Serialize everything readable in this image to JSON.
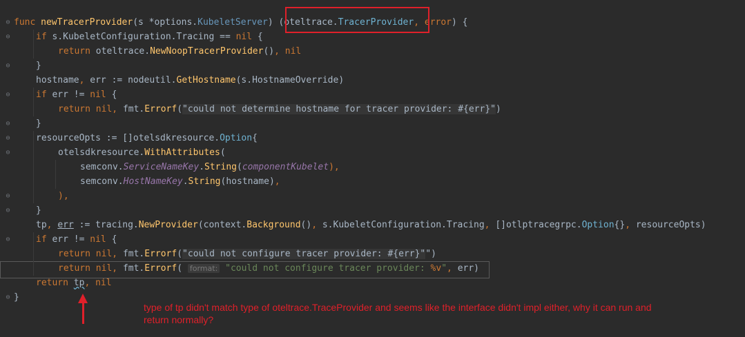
{
  "code_lines": [
    {
      "indent": 0,
      "segments": [
        [
          "kw",
          "func "
        ],
        [
          "fn",
          "newTracerProvider"
        ],
        [
          "",
          "(s *options."
        ],
        [
          "typ",
          "KubeletServer"
        ],
        [
          "",
          ") ("
        ],
        [
          "",
          "oteltrace."
        ],
        [
          "cyan",
          "TracerProvider"
        ],
        [
          "kw",
          ", "
        ],
        [
          "kw",
          "error"
        ],
        [
          "",
          ") {"
        ]
      ]
    },
    {
      "indent": 1,
      "segments": [
        [
          "kw",
          "if "
        ],
        [
          "",
          "s.KubeletConfiguration.Tracing == "
        ],
        [
          "kw",
          "nil"
        ],
        [
          "",
          " {"
        ]
      ]
    },
    {
      "indent": 2,
      "segments": [
        [
          "kw",
          "return "
        ],
        [
          "",
          "oteltrace."
        ],
        [
          "fn",
          "NewNoopTracerProvider"
        ],
        [
          "",
          "()"
        ],
        [
          "kw",
          ", nil"
        ]
      ]
    },
    {
      "indent": 1,
      "segments": [
        [
          "",
          "}"
        ]
      ]
    },
    {
      "indent": 1,
      "segments": [
        [
          "",
          "hostname"
        ],
        [
          "kw",
          ", "
        ],
        [
          "",
          "err := nodeutil."
        ],
        [
          "fn",
          "GetHostname"
        ],
        [
          "",
          "(s.HostnameOverride)"
        ]
      ]
    },
    {
      "indent": 1,
      "segments": [
        [
          "kw",
          "if "
        ],
        [
          "",
          "err != "
        ],
        [
          "kw",
          "nil"
        ],
        [
          "",
          " {"
        ]
      ]
    },
    {
      "indent": 2,
      "segments": [
        [
          "kw",
          "return "
        ],
        [
          "kw",
          "nil"
        ],
        [
          "kw",
          ", "
        ],
        [
          "",
          "fmt."
        ],
        [
          "fn",
          "Errorf"
        ],
        [
          "",
          "("
        ],
        [
          "strbg",
          "\"could not determine hostname for tracer provider: #{err}\""
        ],
        [
          "",
          ")"
        ]
      ]
    },
    {
      "indent": 1,
      "segments": [
        [
          "",
          "}"
        ]
      ]
    },
    {
      "indent": 1,
      "segments": [
        [
          "",
          "resourceOpts := []otelsdkresource."
        ],
        [
          "cyan",
          "Option"
        ],
        [
          "",
          "{"
        ]
      ]
    },
    {
      "indent": 2,
      "segments": [
        [
          "",
          "otelsdkresource."
        ],
        [
          "fn",
          "WithAttributes"
        ],
        [
          "",
          "("
        ]
      ]
    },
    {
      "indent": 3,
      "segments": [
        [
          "",
          "semconv."
        ],
        [
          "pur",
          "ServiceNameKey"
        ],
        [
          "",
          "."
        ],
        [
          "fn",
          "String"
        ],
        [
          "",
          "("
        ],
        [
          "pur",
          "componentKubelet"
        ],
        [
          "kw",
          "),"
        ]
      ]
    },
    {
      "indent": 3,
      "segments": [
        [
          "",
          "semconv."
        ],
        [
          "pur",
          "HostNameKey"
        ],
        [
          "",
          "."
        ],
        [
          "fn",
          "String"
        ],
        [
          "",
          "(hostname)"
        ],
        [
          "kw",
          ","
        ]
      ]
    },
    {
      "indent": 2,
      "segments": [
        [
          "kw",
          "),"
        ]
      ]
    },
    {
      "indent": 1,
      "segments": [
        [
          "",
          "}"
        ]
      ]
    },
    {
      "indent": 1,
      "segments": [
        [
          "",
          "tp"
        ],
        [
          "kw",
          ", "
        ],
        [
          "uerr",
          "err"
        ],
        [
          "",
          " := tracing."
        ],
        [
          "fn",
          "NewProvider"
        ],
        [
          "",
          "(context."
        ],
        [
          "fn",
          "Background"
        ],
        [
          "",
          "()"
        ],
        [
          "kw",
          ", "
        ],
        [
          "",
          "s.KubeletConfiguration.Tracing"
        ],
        [
          "kw",
          ", "
        ],
        [
          "",
          "[]otlptracegrpc."
        ],
        [
          "cyan",
          "Option"
        ],
        [
          "",
          "{}"
        ],
        [
          "kw",
          ", "
        ],
        [
          "",
          "resourceOpts)"
        ]
      ]
    },
    {
      "indent": 1,
      "segments": [
        [
          "kw",
          "if "
        ],
        [
          "",
          "err != "
        ],
        [
          "kw",
          "nil"
        ],
        [
          "",
          " {"
        ]
      ]
    },
    {
      "indent": 2,
      "segments": [
        [
          "kw",
          "return "
        ],
        [
          "kw",
          "nil"
        ],
        [
          "kw",
          ", "
        ],
        [
          "",
          "fmt."
        ],
        [
          "fn",
          "Errorf"
        ],
        [
          "",
          "("
        ],
        [
          "strbg",
          "\"could not configure tracer provider: #{err}\""
        ],
        [
          "",
          "\")"
        ]
      ]
    },
    {
      "indent": 2,
      "segments": [
        [
          "kw",
          "return "
        ],
        [
          "kw",
          "nil"
        ],
        [
          "kw",
          ", "
        ],
        [
          "",
          "fmt."
        ],
        [
          "fn",
          "Errorf"
        ],
        [
          "",
          "( "
        ],
        [
          "hint",
          "format:"
        ],
        [
          "",
          " "
        ],
        [
          "str",
          "\"could not configure tracer provider: "
        ],
        [
          "kw",
          "%v"
        ],
        [
          "str",
          "\""
        ],
        [
          "kw",
          ", "
        ],
        [
          "",
          "err)"
        ]
      ]
    },
    {
      "indent": 1,
      "segments": [
        [
          "kw",
          "return "
        ],
        [
          "utp",
          "tp"
        ],
        [
          "kw",
          ", nil"
        ]
      ]
    },
    {
      "indent": 0,
      "segments": [
        [
          "",
          "}"
        ]
      ]
    }
  ],
  "annotation": "type of tp didn't match type of oteltrace.TraceProvider and seems like the interface didn't impl either, why it can run and return normally?"
}
